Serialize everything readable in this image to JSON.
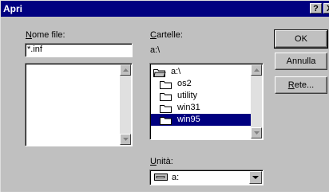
{
  "window": {
    "title": "Apri",
    "help_label": "?",
    "close_label": "X"
  },
  "filename": {
    "label_accel": "N",
    "label_rest": "ome file:",
    "value": "*.inf",
    "files": []
  },
  "folders": {
    "label_accel": "C",
    "label_rest": "artelle:",
    "current_path": "a:\\",
    "items": [
      {
        "name": "a:\\",
        "icon": "open-folder-icon"
      },
      {
        "name": "os2",
        "icon": "folder-icon"
      },
      {
        "name": "utility",
        "icon": "folder-icon"
      },
      {
        "name": "win31",
        "icon": "folder-icon"
      },
      {
        "name": "win95",
        "icon": "folder-icon",
        "selected": true
      }
    ]
  },
  "drive": {
    "label_accel": "U",
    "label_rest": "nità:",
    "value": "a:",
    "icon": "floppy-drive-icon"
  },
  "buttons": {
    "ok": "OK",
    "cancel": "Annulla",
    "network_accel": "R",
    "network_rest": "ete..."
  }
}
